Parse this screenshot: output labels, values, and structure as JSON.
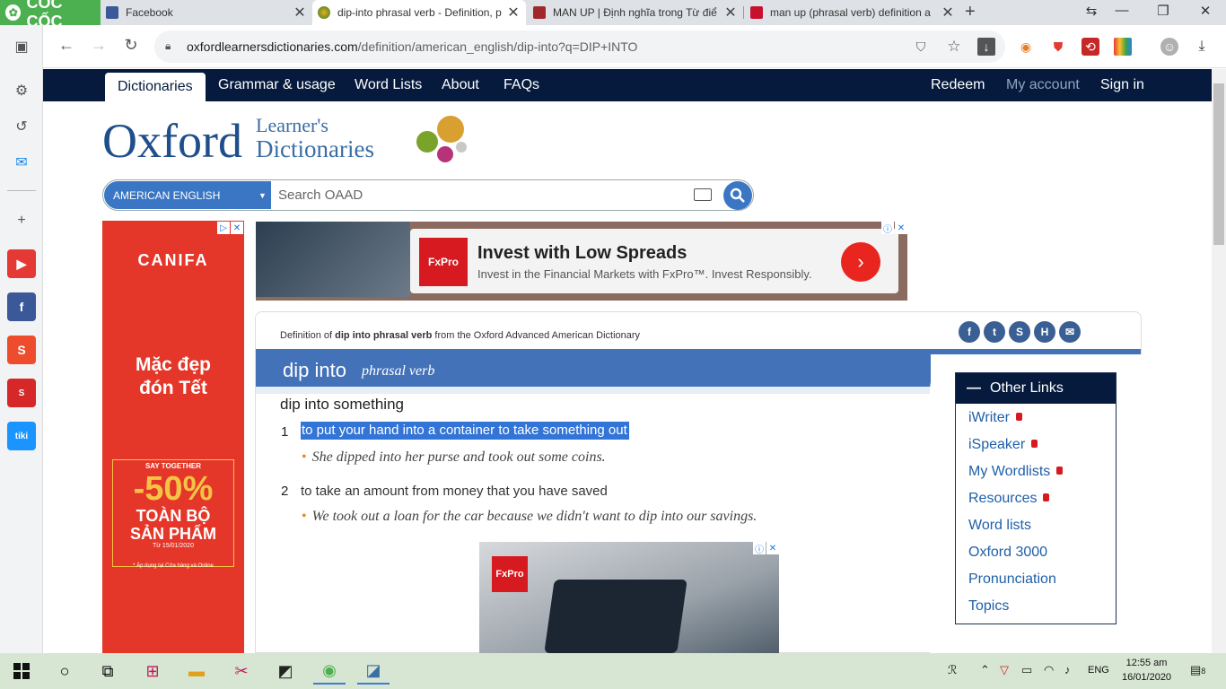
{
  "browser": {
    "brand": "CỐC CỐC",
    "tabs": [
      {
        "title": "Facebook"
      },
      {
        "title": "dip-into phrasal verb - Definition, p"
      },
      {
        "title": "MAN UP | Định nghĩa trong Từ điể"
      },
      {
        "title": "man up (phrasal verb) definition a"
      }
    ],
    "url_host": "oxfordlearnersdictionaries.com",
    "url_path": "/definition/american_english/dip-into?q=DIP+INTO"
  },
  "sidebar": {
    "apps": [
      {
        "name": "youtube",
        "color": "#e53935"
      },
      {
        "name": "facebook",
        "color": "#3b5998"
      },
      {
        "name": "shopee",
        "color": "#ee4d2d"
      },
      {
        "name": "sale",
        "color": "#d62828"
      },
      {
        "name": "tiki",
        "color": "#1a94ff"
      }
    ]
  },
  "site_nav": {
    "left": [
      "Dictionaries",
      "Grammar & usage",
      "Word Lists",
      "About",
      "FAQs"
    ],
    "right": [
      "Redeem",
      "My account",
      "Sign in"
    ]
  },
  "logo": {
    "oxford": "Oxford",
    "learners": "Learner's",
    "dictionaries": "Dictionaries"
  },
  "search": {
    "dictionary": "AMERICAN ENGLISH",
    "placeholder": "Search OAAD"
  },
  "left_ad": {
    "brand": "CANIFA",
    "slogan_1": "Mặc đẹp",
    "slogan_2": "đón Tết",
    "together": "SAY TOGETHER",
    "discount": "-50%",
    "all_1": "TOÀN BỘ",
    "all_2": "SẢN PHẨM",
    "date": "Từ 15/01/2020",
    "note": "* Áp dụng tại Cửa hàng và Online"
  },
  "top_ad": {
    "logo": "FxPro",
    "headline": "Invest with Low Spreads",
    "sub": "Invest in the Financial Markets with FxPro™. Invest Responsibly."
  },
  "entry": {
    "from_prefix": "Definition of ",
    "from_word": "dip into phrasal verb",
    "from_suffix": " from the Oxford Advanced American Dictionary",
    "headword": "dip into",
    "pos": "phrasal verb",
    "frame": "dip into something",
    "senses": [
      {
        "num": "1",
        "def": "to put your hand into a container to take something out",
        "example": "She dipped into her purse and took out some coins."
      },
      {
        "num": "2",
        "def": "to take an amount from money that you have saved",
        "example": "We took out a loan for the car because we didn't want to dip into our savings."
      }
    ]
  },
  "bottom_ad": {
    "logo": "FxPro"
  },
  "other_links": {
    "title": "Other Links",
    "items": [
      {
        "label": "iWriter",
        "locked": true
      },
      {
        "label": "iSpeaker",
        "locked": true
      },
      {
        "label": "My Wordlists",
        "locked": true
      },
      {
        "label": "Resources",
        "locked": true
      },
      {
        "label": "Word lists",
        "locked": false
      },
      {
        "label": "Oxford 3000",
        "locked": false
      },
      {
        "label": "Pronunciation",
        "locked": false
      },
      {
        "label": "Topics",
        "locked": false
      }
    ]
  },
  "taskbar": {
    "lang": "ENG",
    "time": "12:55 am",
    "date": "16/01/2020",
    "notifications": "8"
  },
  "colors": {
    "oxford_navy": "#051a3d",
    "oxford_blue": "#4372b8",
    "selection": "#3374d7",
    "canifa_red": "#e4372a"
  }
}
